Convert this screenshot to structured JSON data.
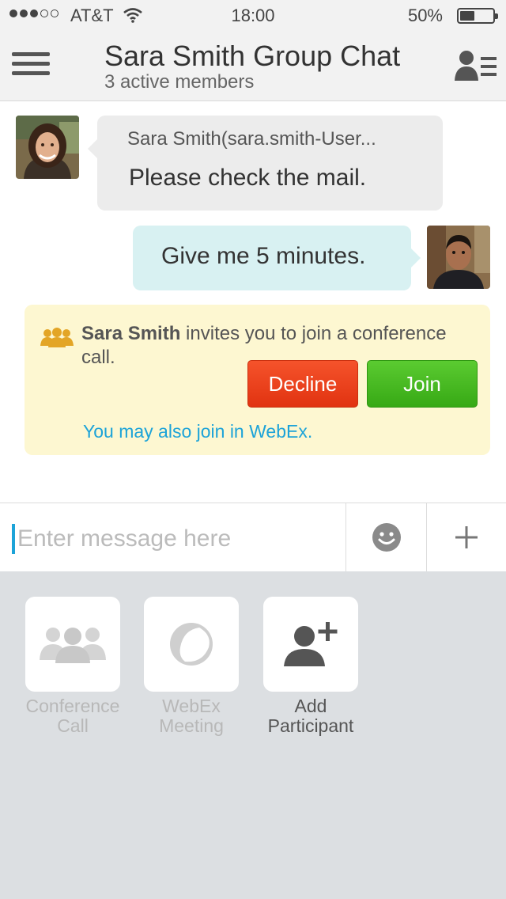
{
  "status_bar": {
    "carrier": "AT&T",
    "time": "18:00",
    "battery": "50%",
    "battery_level": 0.5,
    "signal_bars_filled": 3,
    "signal_bars_total": 5
  },
  "header": {
    "title": "Sara Smith Group Chat",
    "subtitle": "3 active members",
    "menu_icon": "hamburger-icon",
    "participants_icon": "participants-list-icon"
  },
  "messages": [
    {
      "direction": "incoming",
      "sender": "Sara Smith(sara.smith-User...",
      "text": "Please check the mail.",
      "avatar": "sara-smith-avatar"
    },
    {
      "direction": "outgoing",
      "text": "Give me 5 minutes.",
      "avatar": "self-avatar"
    }
  ],
  "invite": {
    "inviter": "Sara Smith",
    "text": " invites you to join a conference call.",
    "decline_label": "Decline",
    "join_label": "Join",
    "webex_link": "You may also join in WebEx.",
    "icon": "group-icon"
  },
  "composer": {
    "placeholder": "Enter message here",
    "value": "",
    "emoji_icon": "smiley-icon",
    "plus_icon": "plus-icon"
  },
  "actions": [
    {
      "label": "Conference\nCall",
      "icon": "conference-call-icon",
      "enabled": false
    },
    {
      "label": "WebEx\nMeeting",
      "icon": "webex-icon",
      "enabled": false
    },
    {
      "label": "Add\nParticipant",
      "icon": "add-participant-icon",
      "enabled": true
    }
  ],
  "colors": {
    "accent": "#1ca3d8",
    "decline": "#e8401b",
    "join": "#44b81f",
    "incoming_bubble": "#ececec",
    "outgoing_bubble": "#d8f1f2",
    "invite_bg": "#fdf7d1",
    "panel_bg": "#dcdfe2"
  }
}
